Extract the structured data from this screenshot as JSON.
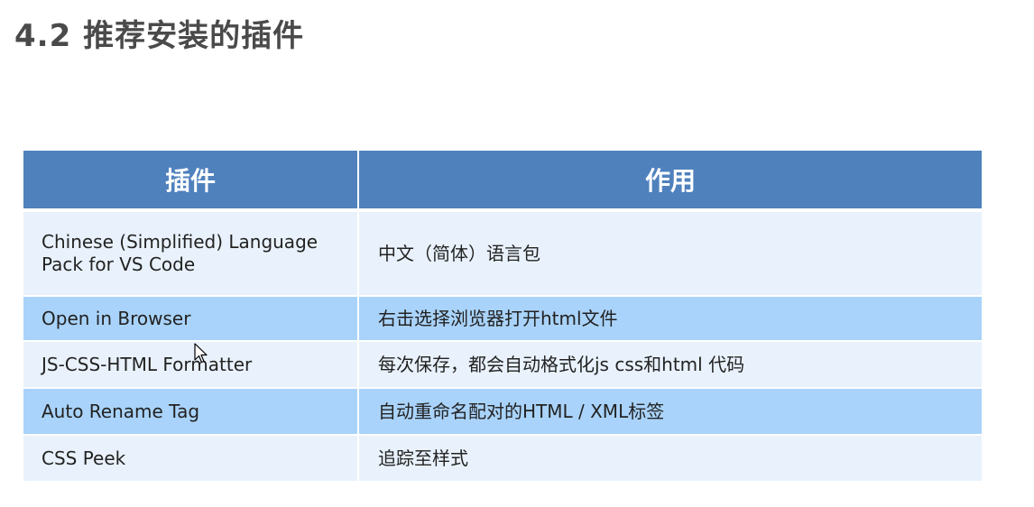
{
  "title": "4.2 推荐安装的插件",
  "table": {
    "headers": [
      "插件",
      "作用"
    ],
    "rows": [
      {
        "plugin": "Chinese (Simplified) Language Pack for VS Code",
        "purpose": "中文（简体）语言包"
      },
      {
        "plugin": "Open in Browser",
        "purpose": "右击选择浏览器打开html文件"
      },
      {
        "plugin": "JS-CSS-HTML Formatter",
        "purpose": "每次保存，都会自动格式化js  css和html 代码"
      },
      {
        "plugin": "Auto Rename Tag",
        "purpose": "自动重命名配对的HTML / XML标签"
      },
      {
        "plugin": "CSS Peek",
        "purpose": "追踪至样式"
      }
    ]
  },
  "colors": {
    "header_bg": "#4f81bd",
    "row_light": "#e9f2fc",
    "row_dark": "#a9d3fa",
    "title_text": "#4a4a4a"
  },
  "icons": {
    "cursor": "mouse-pointer-icon"
  }
}
